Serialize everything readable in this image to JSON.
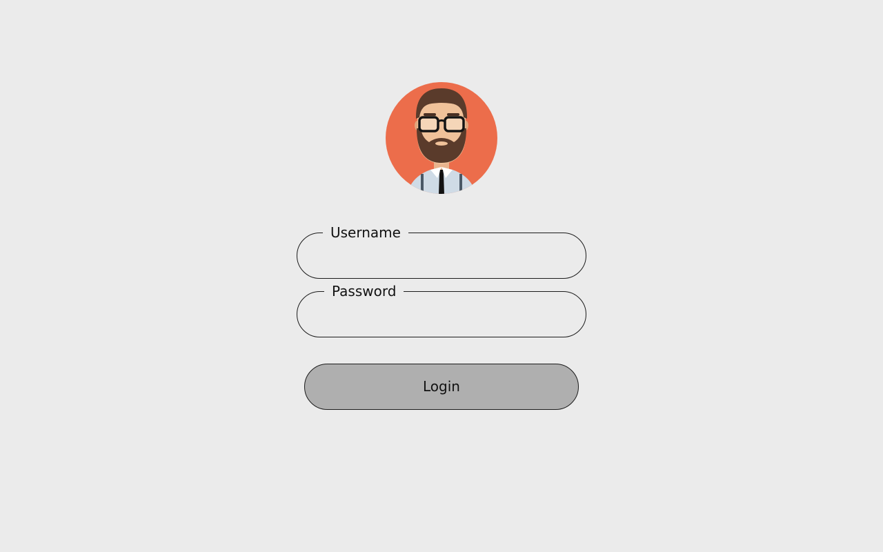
{
  "avatar": {
    "icon": "bearded-man-avatar-icon",
    "background_color": "#ec6d4b"
  },
  "form": {
    "username": {
      "label": "Username",
      "value": "",
      "placeholder": ""
    },
    "password": {
      "label": "Password",
      "value": "",
      "placeholder": ""
    },
    "login_button": {
      "label": "Login",
      "background_color": "#afafaf"
    }
  },
  "colors": {
    "page_background": "#ebebeb",
    "border": "#1a1a1a"
  }
}
